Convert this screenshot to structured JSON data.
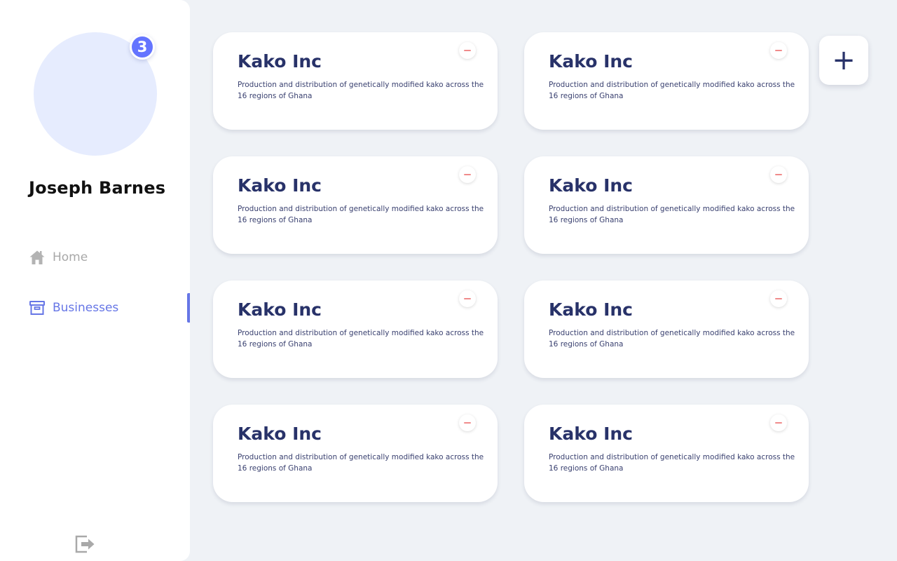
{
  "user": {
    "name": "Joseph Barnes",
    "notification_count": "3"
  },
  "nav": {
    "home_label": "Home",
    "businesses_label": "Businesses"
  },
  "add_button": {
    "label": "+"
  },
  "businesses": [
    {
      "name": "Kako Inc",
      "description": "Production and distribution of genetically modified kako across the 16 regions of Ghana"
    },
    {
      "name": "Kako Inc",
      "description": "Production and distribution of genetically modified kako across the 16 regions of Ghana"
    },
    {
      "name": "Kako Inc",
      "description": "Production and distribution of genetically modified kako across the 16 regions of Ghana"
    },
    {
      "name": "Kako Inc",
      "description": "Production and distribution of genetically modified kako across the 16 regions of Ghana"
    },
    {
      "name": "Kako Inc",
      "description": "Production and distribution of genetically modified kako across the 16 regions of Ghana"
    },
    {
      "name": "Kako Inc",
      "description": "Production and distribution of genetically modified kako across the 16 regions of Ghana"
    },
    {
      "name": "Kako Inc",
      "description": "Production and distribution of genetically modified kako across the 16 regions of Ghana"
    },
    {
      "name": "Kako Inc",
      "description": "Production and distribution of genetically modified kako across the 16 regions of Ghana"
    }
  ],
  "colors": {
    "accent": "#6474ff",
    "nav_active": "#6676e6",
    "title_navy": "#283269",
    "remove_red": "#f08b8b",
    "background": "#eff2f6"
  },
  "icons": {
    "home": "home-icon",
    "businesses": "archive-box-icon",
    "logout": "logout-icon",
    "remove": "minus-icon"
  }
}
